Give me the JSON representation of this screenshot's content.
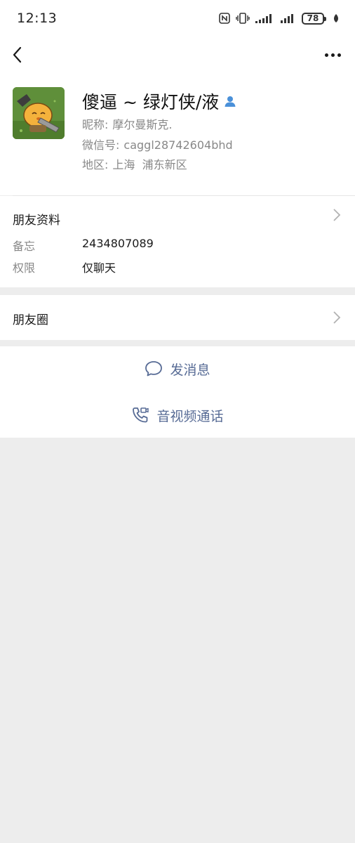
{
  "status_bar": {
    "time": "12:13",
    "battery": "78",
    "icons": [
      "nfc-icon",
      "vibrate-icon",
      "signal-icon",
      "signal-icon",
      "battery-icon",
      "leaf-icon"
    ]
  },
  "nav": {
    "back_icon": "back-chevron-icon",
    "more_icon": "more-dots-icon"
  },
  "profile": {
    "display_name": "傻逼 ~ 绿灯侠/液",
    "nickname_label": "昵称:",
    "nickname": "摩尔曼斯克.",
    "wechat_id_label": "微信号:",
    "wechat_id": "caggl28742604bhd",
    "region_label": "地区:",
    "region": "上海  浦东新区",
    "gender_icon": "male-person-icon"
  },
  "friend_info": {
    "title": "朋友资料",
    "remark_label": "备忘",
    "remark_value": "2434807089",
    "permission_label": "权限",
    "permission_value": "仅聊天"
  },
  "moments": {
    "label": "朋友圈"
  },
  "actions": {
    "message_label": "发消息",
    "call_label": "音视频通话"
  },
  "colors": {
    "link_blue": "#576b95",
    "background": "#ededed",
    "card": "#ffffff",
    "secondary_text": "#888888"
  }
}
